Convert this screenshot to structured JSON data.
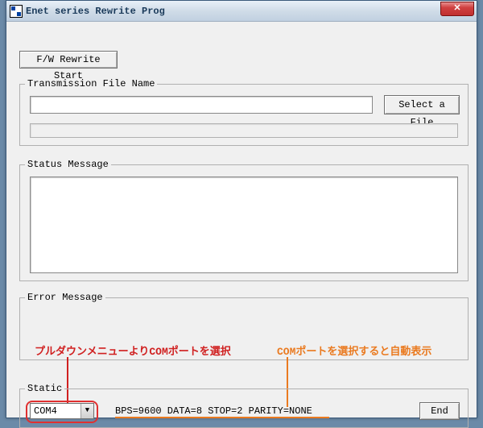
{
  "window": {
    "title": "Enet series Rewrite Prog",
    "close_symbol": "✕"
  },
  "buttons": {
    "fw_rewrite": "F/W Rewrite Start",
    "select_file": "Select a File",
    "end": "End"
  },
  "groups": {
    "filename_legend": "Transmission File Name",
    "status_legend": "Status Message",
    "error_legend": "Error Message",
    "static_legend": "Static"
  },
  "static": {
    "com_selected": "COM4",
    "params": "BPS=9600  DATA=8  STOP=2  PARITY=NONE"
  },
  "annotations": {
    "pulldown_hint": "プルダウンメニューよりCOMポートを選択",
    "auto_display_hint": "COMポートを選択すると自動表示"
  },
  "fields": {
    "filename_value": "",
    "status_value": "",
    "error_value": ""
  },
  "colors": {
    "annotation_red": "#d02020",
    "annotation_orange": "#ea7a20"
  }
}
